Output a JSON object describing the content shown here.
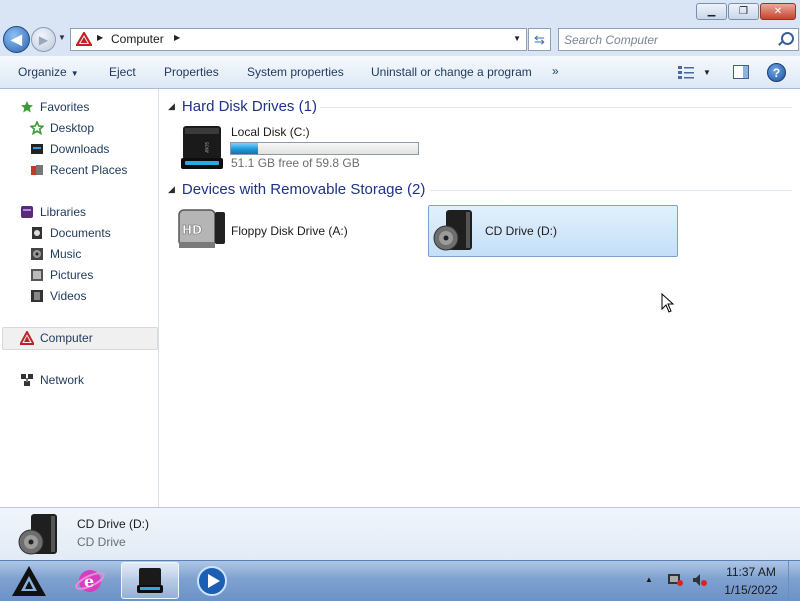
{
  "window": {
    "minimize_symbol": "▁",
    "restore_symbol": "❐",
    "close_symbol": "✕"
  },
  "address_bar": {
    "path": "Computer",
    "search_placeholder": "Search Computer"
  },
  "toolbar": {
    "organize": "Organize",
    "eject": "Eject",
    "properties": "Properties",
    "system_properties": "System properties",
    "uninstall": "Uninstall or change a program",
    "more": "»"
  },
  "nav": {
    "favorites": "Favorites",
    "desktop": "Desktop",
    "downloads": "Downloads",
    "recent_places": "Recent Places",
    "libraries": "Libraries",
    "documents": "Documents",
    "music": "Music",
    "pictures": "Pictures",
    "videos": "Videos",
    "computer": "Computer",
    "network": "Network"
  },
  "content": {
    "hdd_group": "Hard Disk Drives (1)",
    "removable_group": "Devices with Removable Storage (2)",
    "local_disk": {
      "label": "Local Disk (C:)",
      "free_text": "51.1 GB free of 59.8 GB",
      "used_fraction": 0.145
    },
    "floppy": {
      "label": "Floppy Disk Drive (A:)"
    },
    "cd": {
      "label": "CD Drive (D:)"
    }
  },
  "details": {
    "name": "CD Drive (D:)",
    "type": "CD Drive"
  },
  "taskbar": {
    "time": "11:37 AM",
    "date": "1/15/2022"
  },
  "colors": {
    "accent": "#1e395b",
    "group_header": "#1e3287",
    "selection": "#c4dff7",
    "usage_bar": "#1d9ad8"
  }
}
